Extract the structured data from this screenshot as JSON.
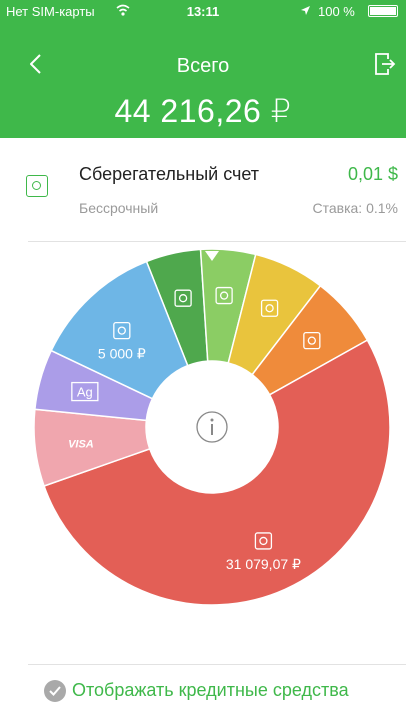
{
  "status_bar": {
    "carrier": "Нет SIM-карты",
    "time": "13:11",
    "battery": "100 %"
  },
  "header": {
    "title": "Всего",
    "total": "44 216,26 ₽",
    "bg_color": "#3fb84a"
  },
  "account": {
    "name": "Сберегательный счет",
    "amount": "0,01 $",
    "term": "Бессрочный",
    "rate": "Ставка: 0.1%",
    "icon": "safe-icon"
  },
  "chart_data": {
    "type": "pie",
    "style": "donut",
    "segments": [
      {
        "label": "",
        "icon": "safe-icon",
        "value_fraction": 0.05,
        "color": "#4fa84d"
      },
      {
        "label": "",
        "icon": "safe-icon",
        "value_fraction": 0.05,
        "color": "#8bcd64"
      },
      {
        "label": "",
        "icon": "safe-icon",
        "value_fraction": 0.065,
        "color": "#e9c43d"
      },
      {
        "label": "",
        "icon": "safe-icon",
        "value_fraction": 0.065,
        "color": "#ef8b3b"
      },
      {
        "label": "31 079,07 ₽",
        "icon": "safe-icon",
        "value_fraction": 0.53,
        "color": "#e35f56"
      },
      {
        "label": "",
        "icon": "visa-card-icon",
        "icon_text": "VISA",
        "value_fraction": 0.07,
        "color": "#f0a6ae"
      },
      {
        "label": "",
        "icon": "metal-account-icon",
        "icon_text": "Ag",
        "value_fraction": 0.055,
        "color": "#ab9de8"
      },
      {
        "label": "5 000 ₽",
        "icon": "safe-icon",
        "value_fraction": 0.12,
        "color": "#6eb6e6"
      }
    ],
    "center_icon": "info-icon"
  },
  "footer": {
    "credit_toggle_label": "Отображать кредитные средства",
    "checked": true
  }
}
